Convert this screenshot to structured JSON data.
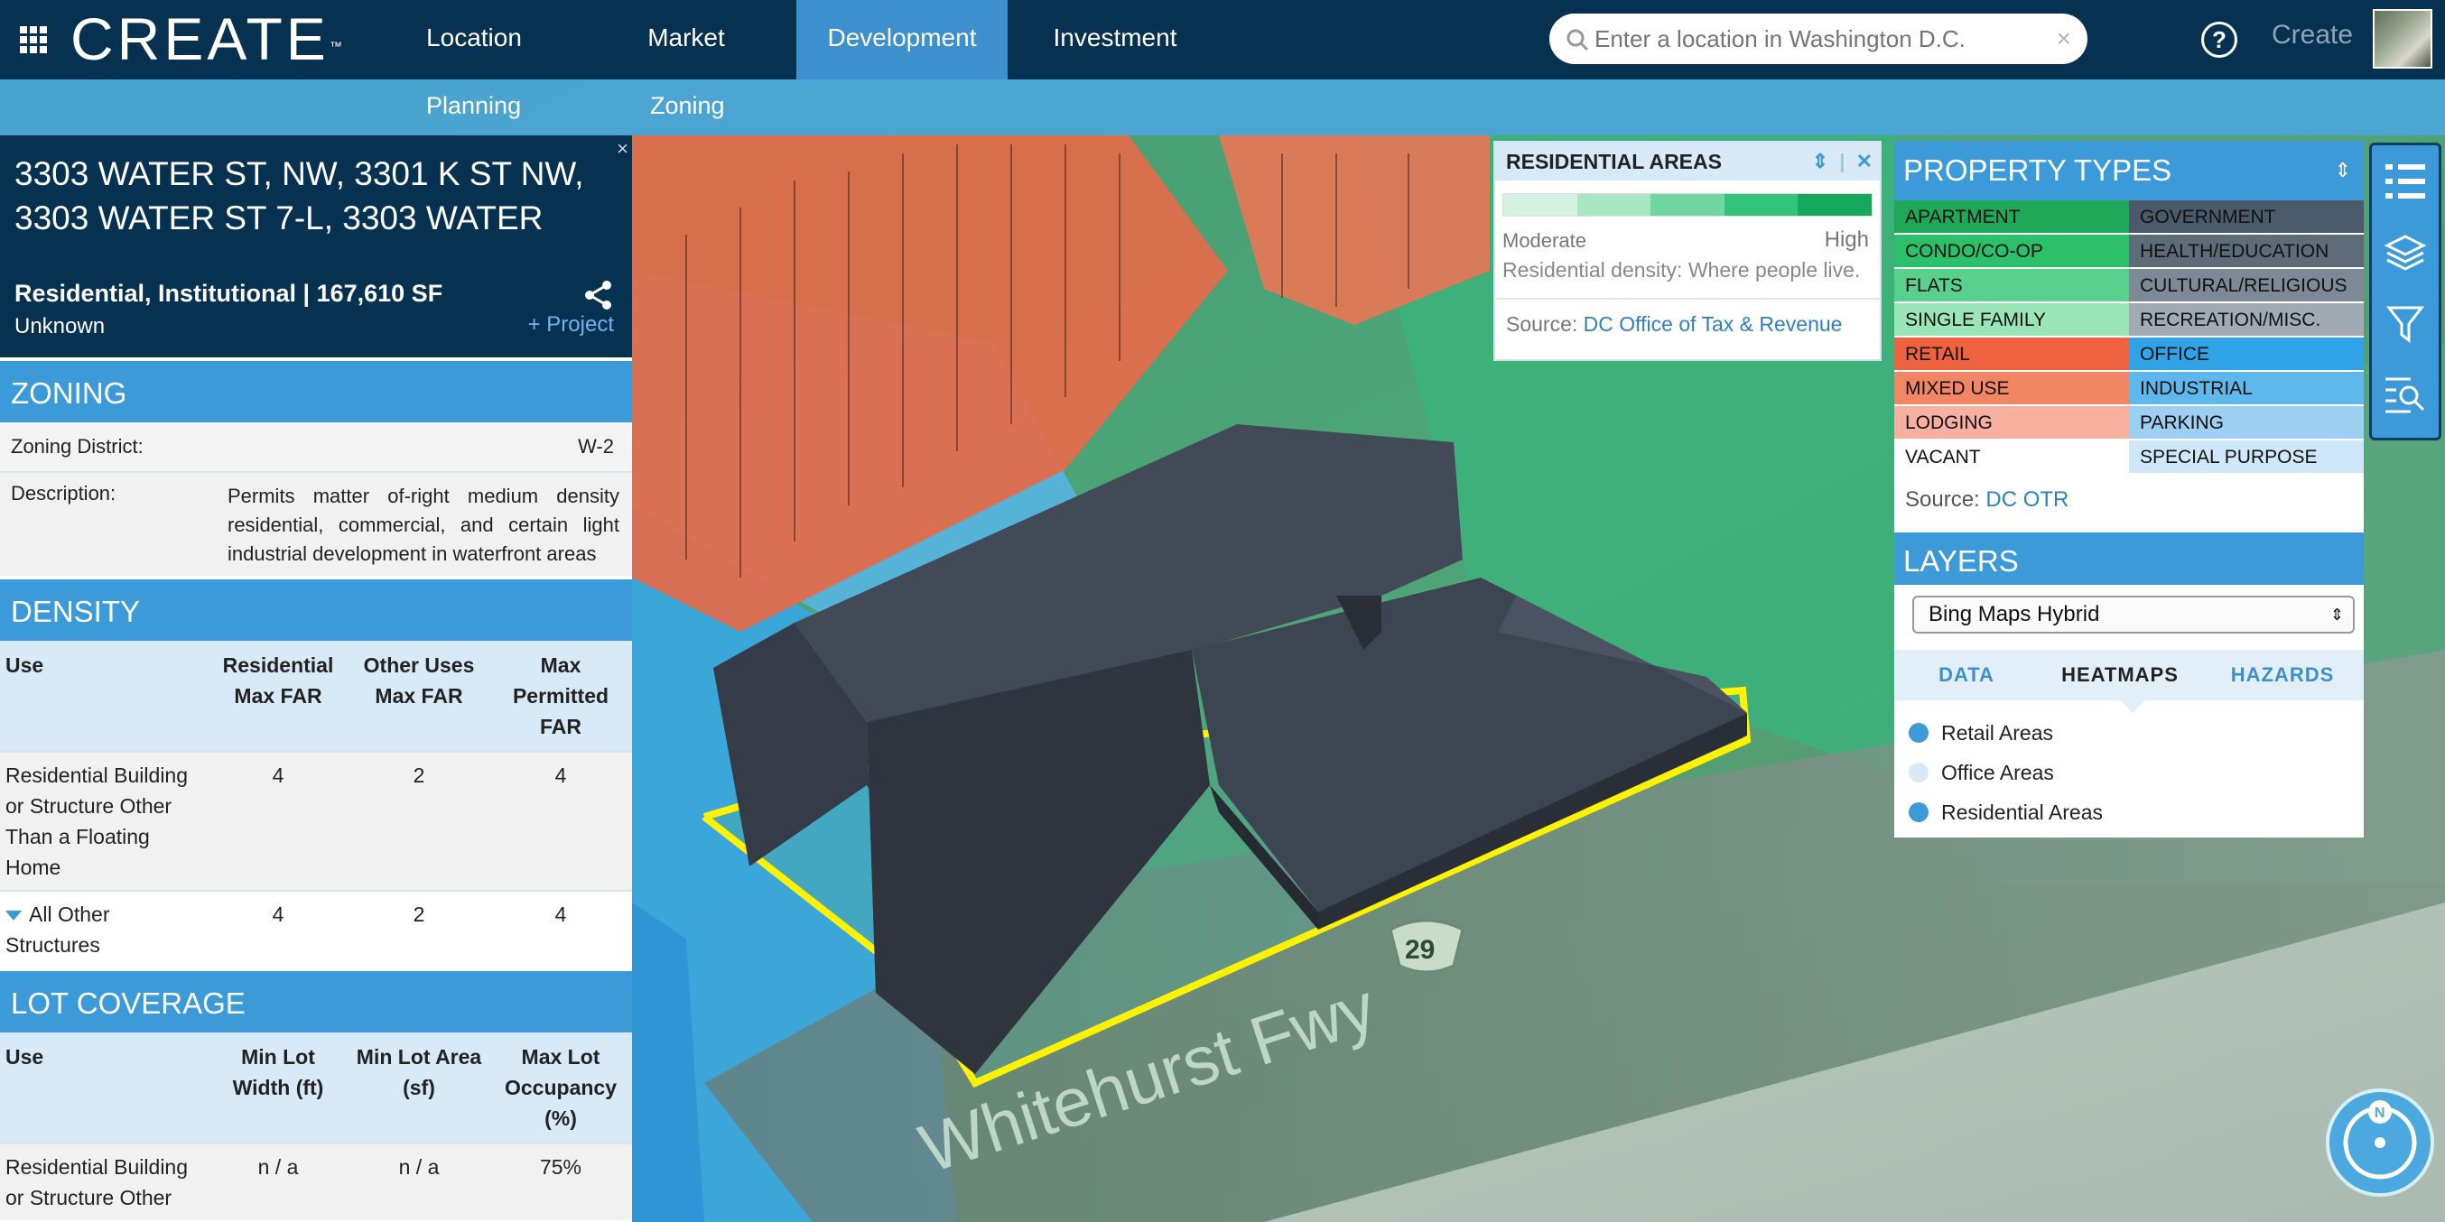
{
  "nav": {
    "logo": "CREATE",
    "logo_mark": "™",
    "items": [
      "Location",
      "Market",
      "Development",
      "Investment"
    ],
    "active": "Development",
    "search_placeholder": "Enter a location in Washington D.C.",
    "clear": "×",
    "help": "?",
    "user_label": "Create"
  },
  "subnav": {
    "items": [
      "Planning",
      "Zoning"
    ]
  },
  "property": {
    "address": "3303 WATER ST, NW, 3301 K ST NW, 3303 WATER ST 7-L, 3303 WATER",
    "use_summary": "Residential, Institutional | 167,610 SF",
    "status": "Unknown",
    "add_project": "+ Project",
    "close": "×"
  },
  "zoning": {
    "title": "ZONING",
    "district_label": "Zoning District:",
    "district_value": "W-2",
    "description_label": "Description:",
    "description_value": "Permits matter of-right medium density residential, commercial, and certain light industrial development in waterfront areas"
  },
  "density": {
    "title": "DENSITY",
    "headers": [
      "Use",
      "Residential Max FAR",
      "Other Uses Max FAR",
      "Max Permitted FAR"
    ],
    "rows": [
      [
        "Residential Building or Structure Other Than a Floating Home",
        "4",
        "2",
        "4"
      ],
      [
        "All Other Structures",
        "4",
        "2",
        "4"
      ]
    ]
  },
  "lot_coverage": {
    "title": "LOT COVERAGE",
    "headers": [
      "Use",
      "Min Lot Width (ft)",
      "Min Lot Area (sf)",
      "Max Lot Occupancy (%)"
    ],
    "rows": [
      [
        "Residential Building or Structure Other",
        "n / a",
        "n / a",
        "75%"
      ]
    ]
  },
  "residential_popup": {
    "title": "RESIDENTIAL AREAS",
    "low_label": "Moderate",
    "high_label": "High",
    "description": "Residential density: Where people live.",
    "source_label": "Source:",
    "source_link": "DC Office of Tax & Revenue",
    "scale_colors": [
      "#d5f2e1",
      "#a7e6c3",
      "#6fd6a0",
      "#32c27a",
      "#16a85c"
    ]
  },
  "property_types": {
    "title": "PROPERTY TYPES",
    "items": [
      {
        "label": "APARTMENT",
        "color": "#20a85a"
      },
      {
        "label": "GOVERNMENT",
        "color": "#4a5a6a"
      },
      {
        "label": "CONDO/CO-OP",
        "color": "#2cc06a"
      },
      {
        "label": "HEALTH/EDUCATION",
        "color": "#5e6c7a"
      },
      {
        "label": "FLATS",
        "color": "#59d18c"
      },
      {
        "label": "CULTURAL/RELIGIOUS",
        "color": "#7d8996"
      },
      {
        "label": "SINGLE FAMILY",
        "color": "#9be6b8"
      },
      {
        "label": "RECREATION/MISC.",
        "color": "#a2abb3"
      },
      {
        "label": "RETAIL",
        "color": "#ef6240"
      },
      {
        "label": "OFFICE",
        "color": "#2fa3e6"
      },
      {
        "label": "MIXED USE",
        "color": "#f28563"
      },
      {
        "label": "INDUSTRIAL",
        "color": "#5fb8ec"
      },
      {
        "label": "LODGING",
        "color": "#f7b0a0"
      },
      {
        "label": "PARKING",
        "color": "#9ccff2"
      },
      {
        "label": "VACANT",
        "color": "#ffffff"
      },
      {
        "label": "SPECIAL PURPOSE",
        "color": "#cfe7f8"
      }
    ],
    "source_label": "Source:",
    "source_link": "DC OTR"
  },
  "layers": {
    "title": "LAYERS",
    "basemap": "Bing Maps Hybrid",
    "tabs": [
      "DATA",
      "HEATMAPS",
      "HAZARDS"
    ],
    "active_tab": "HEATMAPS",
    "heatmaps": [
      {
        "label": "Retail Areas",
        "on": true
      },
      {
        "label": "Office Areas",
        "on": false
      },
      {
        "label": "Residential Areas",
        "on": true
      }
    ]
  },
  "map": {
    "road_label": "Whitehurst Fwy",
    "route_shield": "29",
    "compass_label": "N"
  }
}
